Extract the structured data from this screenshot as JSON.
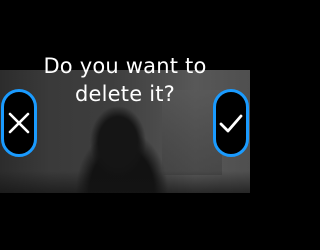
{
  "dialog": {
    "title_line1": "Do you want to",
    "title_line2": "delete it?"
  },
  "buttons": {
    "cancel": {
      "icon": "close-icon"
    },
    "confirm": {
      "icon": "check-icon"
    }
  },
  "colors": {
    "accent": "#1a9bff",
    "background": "#000000",
    "text": "#ffffff"
  }
}
